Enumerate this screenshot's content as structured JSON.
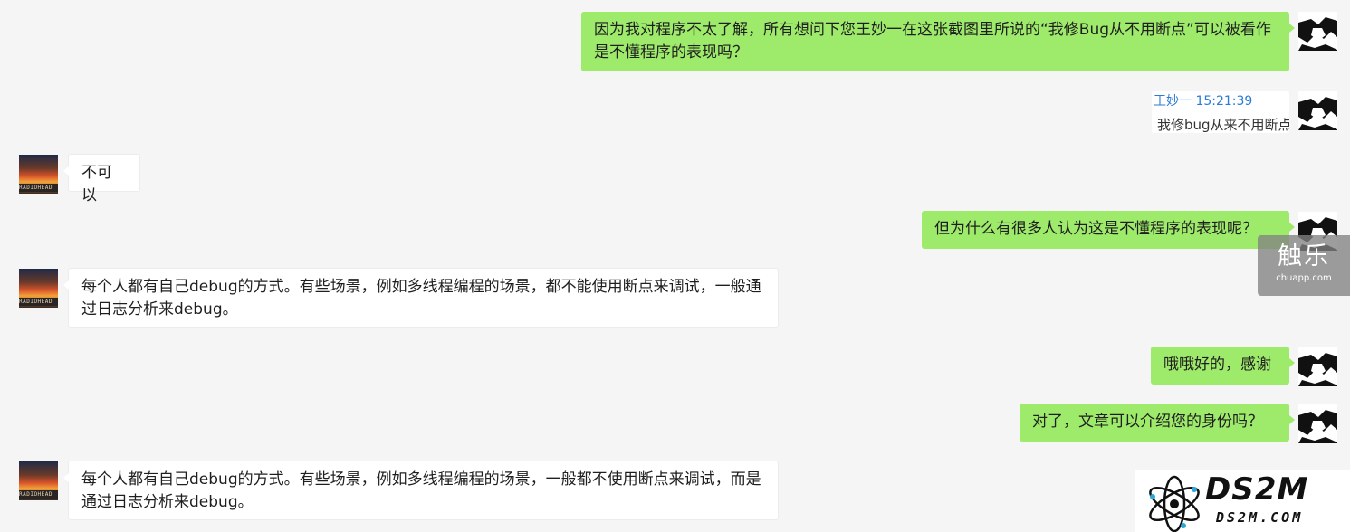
{
  "messages": [
    {
      "side": "me",
      "text": "因为我对程序不太了解，所有想问下您王妙一在这张截图里所说的“我修Bug从不用断点”可以被看作是不懂程序的表现吗？"
    },
    {
      "side": "other",
      "text": "不可以"
    },
    {
      "side": "me",
      "text": "但为什么有很多人认为这是不懂程序的表现呢？"
    },
    {
      "side": "other",
      "text": "每个人都有自己debug的方式。有些场景，例如多线程编程的场景，都不能使用断点来调试，一般通过日志分析来debug。"
    },
    {
      "side": "me",
      "text": "哦哦好的，感谢"
    },
    {
      "side": "me",
      "text": "对了，文章可以介绍您的身份吗？"
    },
    {
      "side": "other",
      "text": "每个人都有自己debug的方式。有些场景，例如多线程编程的场景，一般都不使用断点来调试，而是通过日志分析来debug。"
    }
  ],
  "quoted_image": {
    "header": "王妙一  15:21:39",
    "text": "我修bug从来不用断点"
  },
  "avatar_other": {
    "band_text": "RADIOHEAD"
  },
  "watermarks": {
    "chuapp_title": "触乐",
    "chuapp_url": "chuapp.com",
    "ds2m_brand": "DS2M",
    "ds2m_domain": "DS2M.COM"
  },
  "colors": {
    "me_bubble": "#9eea6a",
    "other_bubble": "#ffffff",
    "background": "#f5f5f5",
    "quote_header": "#2b7bd6"
  }
}
